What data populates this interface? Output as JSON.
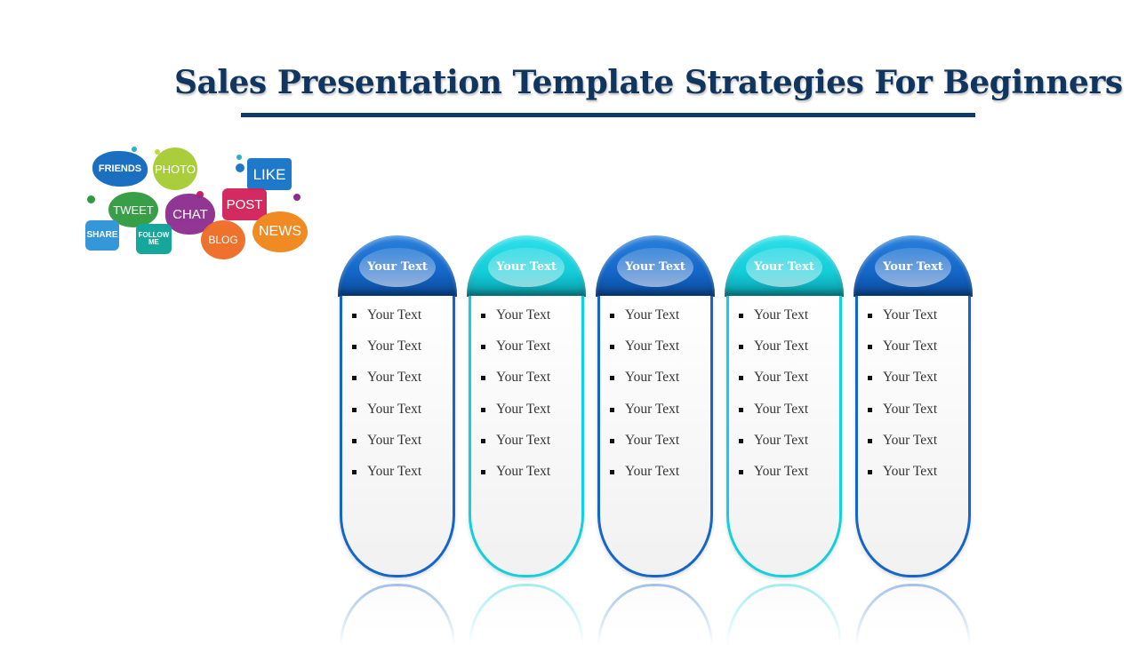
{
  "title": "Sales Presentation Template Strategies For Beginners",
  "colors": {
    "title": "#10355f",
    "blue": "#1466c8",
    "cyan": "#12d0dc"
  },
  "illustration": {
    "icon": "social-media-speech-bubbles",
    "bubbles": [
      {
        "label": "FRIENDS",
        "color": "#1a6fc0"
      },
      {
        "label": "PHOTO",
        "color": "#a9cd3b"
      },
      {
        "label": "LIKE",
        "color": "#1e7ac8"
      },
      {
        "label": "TWEET",
        "color": "#2e9a3f"
      },
      {
        "label": "CHAT",
        "color": "#8c2d8e"
      },
      {
        "label": "POST",
        "color": "#d21f5a"
      },
      {
        "label": "SHARE",
        "color": "#3596d8"
      },
      {
        "label": "FOLLOW ME",
        "color": "#17a69a"
      },
      {
        "label": "BLOG",
        "color": "#ee6a23"
      },
      {
        "label": "NEWS",
        "color": "#f08a22"
      }
    ]
  },
  "columns": [
    {
      "header": "Your Text",
      "color": "blue",
      "items": [
        "Your Text",
        "Your Text",
        "Your Text",
        "Your Text",
        "Your Text",
        "Your Text"
      ]
    },
    {
      "header": "Your Text",
      "color": "cyan",
      "items": [
        "Your Text",
        "Your Text",
        "Your Text",
        "Your Text",
        "Your Text",
        "Your Text"
      ]
    },
    {
      "header": "Your Text",
      "color": "blue",
      "items": [
        "Your Text",
        "Your Text",
        "Your Text",
        "Your Text",
        "Your Text",
        "Your Text"
      ]
    },
    {
      "header": "Your Text",
      "color": "cyan",
      "items": [
        "Your Text",
        "Your Text",
        "Your Text",
        "Your Text",
        "Your Text",
        "Your Text"
      ]
    },
    {
      "header": "Your Text",
      "color": "blue",
      "items": [
        "Your Text",
        "Your Text",
        "Your Text",
        "Your Text",
        "Your Text",
        "Your Text"
      ]
    }
  ]
}
